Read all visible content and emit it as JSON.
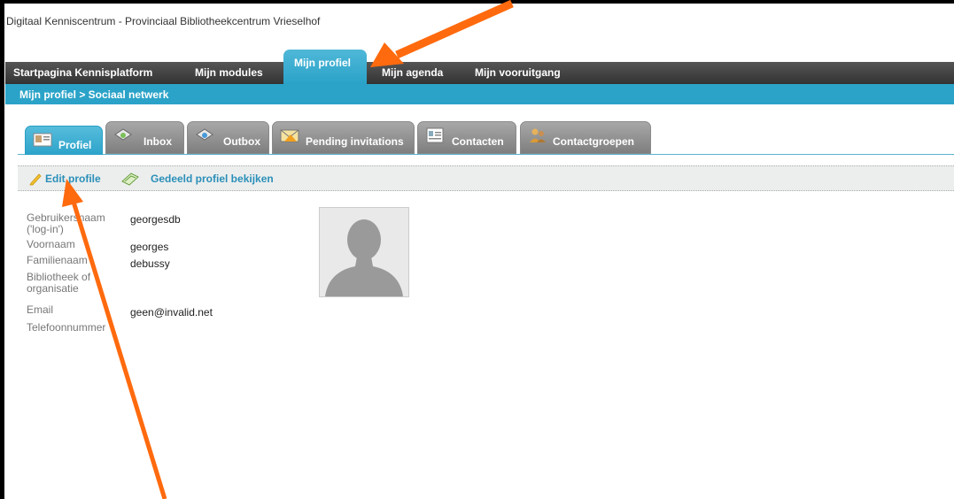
{
  "site": {
    "title": "Digitaal Kenniscentrum - Provinciaal Bibliotheekcentrum Vrieselhof"
  },
  "nav": {
    "items": [
      "Startpagina Kennisplatform",
      "Mijn modules",
      "Mijn agenda",
      "Mijn vooruitgang"
    ],
    "active": "Mijn profiel"
  },
  "breadcrumb": "Mijn profiel > Sociaal netwerk",
  "tabs": [
    "Profiel",
    "Inbox",
    "Outbox",
    "Pending invitations",
    "Contacten",
    "Contactgroepen"
  ],
  "toolbar": {
    "edit_label": "Edit profile",
    "view_label": "Gedeeld profiel bekijken"
  },
  "profile": {
    "fields": [
      {
        "label": "Gebruikersnaam ('log-in')",
        "value": "georgesdb"
      },
      {
        "label": "Voornaam",
        "value": "georges"
      },
      {
        "label": "Familienaam",
        "value": "debussy"
      },
      {
        "label": "Bibliotheek of organisatie",
        "value": ""
      },
      {
        "label": "Email",
        "value": "geen@invalid.net"
      },
      {
        "label": "Telefoonnummer",
        "value": ""
      }
    ]
  },
  "colors": {
    "accent": "#2ba3c8",
    "navbar": "#444444",
    "annotation": "#ff6a0e"
  }
}
